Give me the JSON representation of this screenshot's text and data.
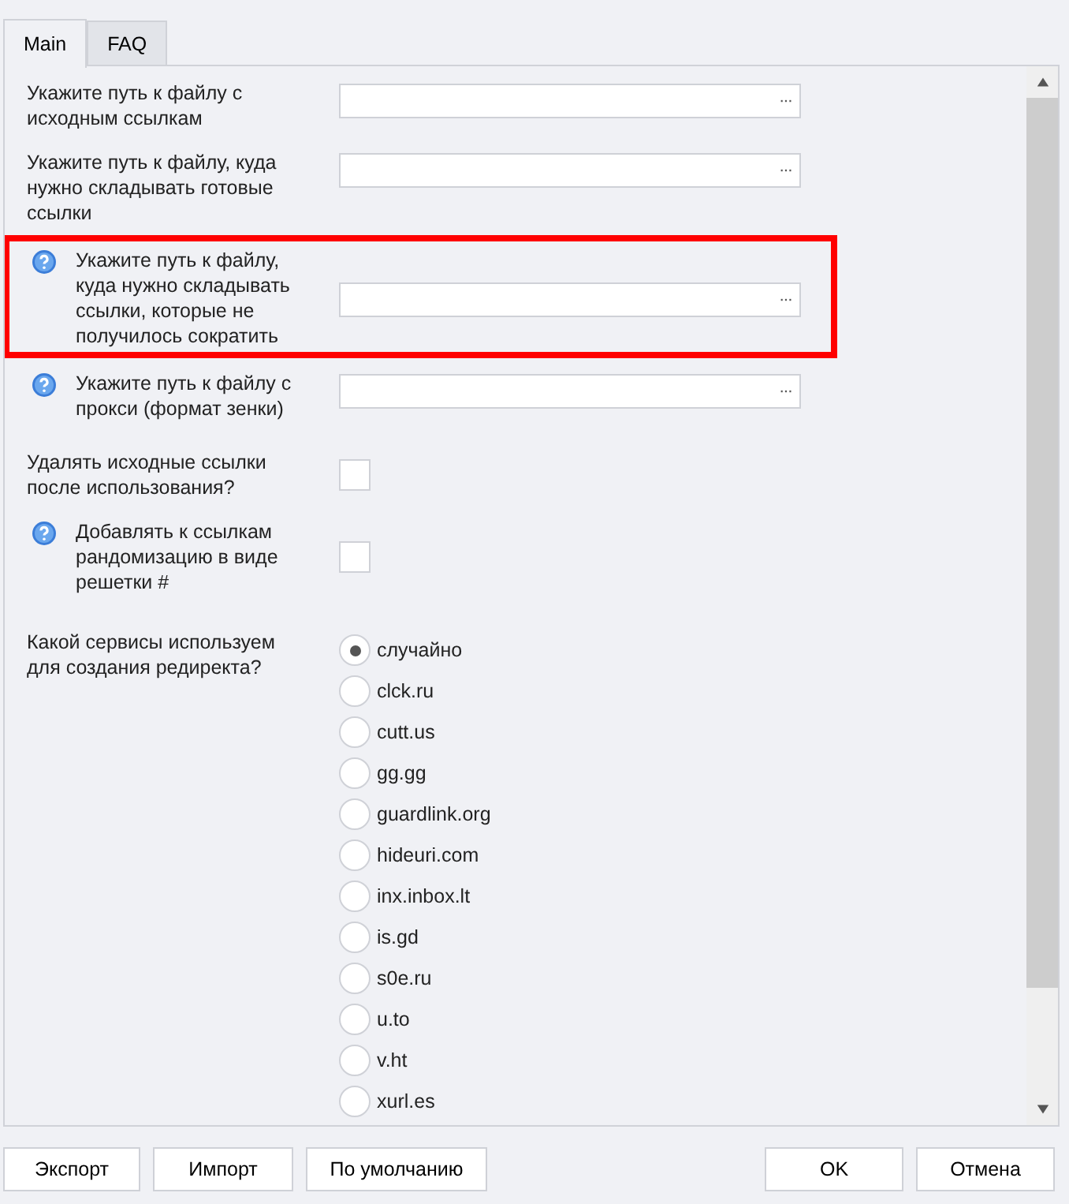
{
  "tabs": [
    {
      "label": "Main",
      "selected": true
    },
    {
      "label": "FAQ",
      "selected": false
    }
  ],
  "settings": [
    {
      "kind": "file",
      "label": "Укажите путь к файлу с исходным ссылкам",
      "browse": "···"
    },
    {
      "kind": "file",
      "label": "Укажите путь к файлу, куда нужно складывать готовые ссылки",
      "browse": "···"
    },
    {
      "kind": "file",
      "label": "Укажите путь к файлу, куда нужно складывать ссылки, которые не получилось сократить",
      "help": true,
      "highlighted": true,
      "browse": "···"
    },
    {
      "kind": "file",
      "label": "Укажите путь к файлу с прокси (формат зенки)",
      "help": true,
      "browse": "···"
    },
    {
      "kind": "checkbox",
      "label": "Удалять исходные ссылки после использования?",
      "checked": false
    },
    {
      "kind": "checkbox",
      "label": "Добавлять к ссылкам рандомизацию в виде решетки #",
      "help": true,
      "checked": false
    },
    {
      "kind": "radio",
      "label": "Какой сервисы используем для создания редиректа?",
      "options": [
        {
          "label": "случайно",
          "selected": true
        },
        {
          "label": "clck.ru",
          "selected": false
        },
        {
          "label": "cutt.us",
          "selected": false
        },
        {
          "label": "gg.gg",
          "selected": false
        },
        {
          "label": "guardlink.org",
          "selected": false
        },
        {
          "label": "hideuri.com",
          "selected": false
        },
        {
          "label": "inx.inbox.lt",
          "selected": false
        },
        {
          "label": "is.gd",
          "selected": false
        },
        {
          "label": "s0e.ru",
          "selected": false
        },
        {
          "label": "u.to",
          "selected": false
        },
        {
          "label": "v.ht",
          "selected": false
        },
        {
          "label": "xurl.es",
          "selected": false
        }
      ]
    }
  ],
  "buttons_left": [
    "Экспорт",
    "Импорт",
    "По умолчанию"
  ],
  "buttons_right": [
    "OK",
    "Отмена"
  ]
}
